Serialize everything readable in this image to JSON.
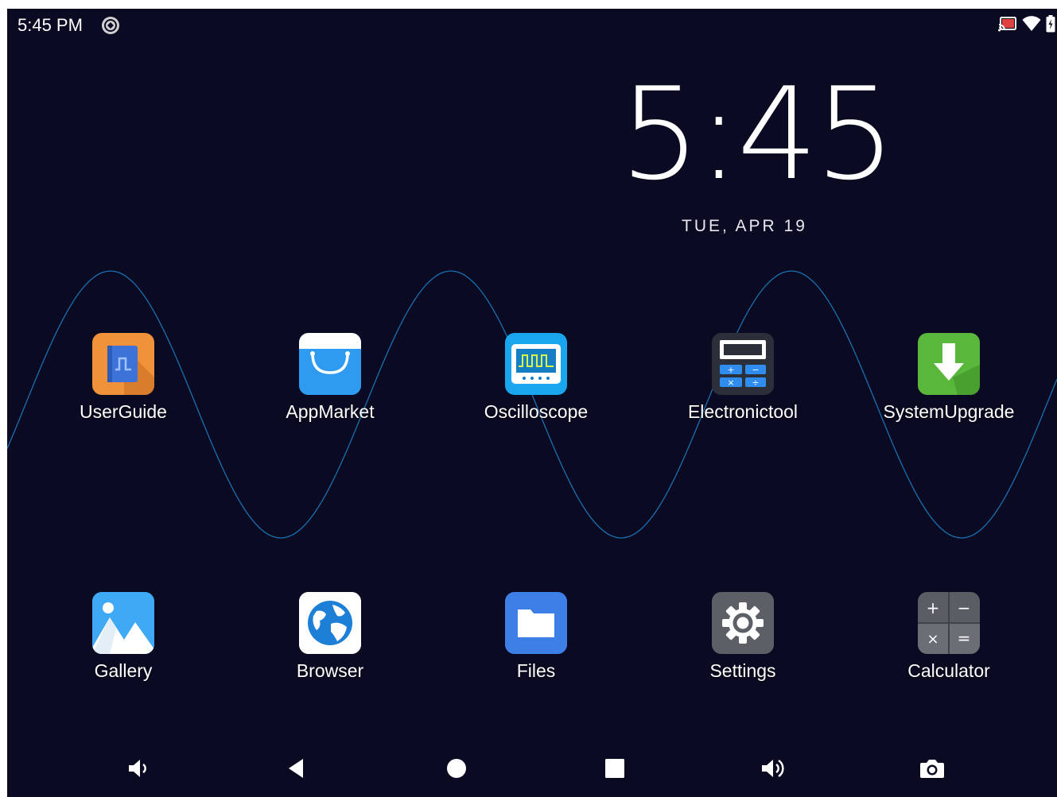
{
  "status_bar": {
    "time": "5:45 PM",
    "left_icons": [
      "notification-icon"
    ],
    "right_icons": [
      "cast-icon",
      "wifi-icon",
      "battery-icon"
    ]
  },
  "clock_widget": {
    "time": "5:45",
    "date": "TUE, APR 19"
  },
  "apps": [
    {
      "label": "UserGuide",
      "icon": "userguide-icon",
      "color": "#f0923a"
    },
    {
      "label": "AppMarket",
      "icon": "appmarket-icon",
      "color": "#2f9bf0"
    },
    {
      "label": "Oscilloscope",
      "icon": "oscilloscope-icon",
      "color": "#1aa6ef"
    },
    {
      "label": "Electronictool",
      "icon": "electronictool-icon",
      "color": "#333844"
    },
    {
      "label": "SystemUpgrade",
      "icon": "systemupgrade-icon",
      "color": "#59b83b"
    },
    {
      "label": "Gallery",
      "icon": "gallery-icon",
      "color": "#3fa9f5"
    },
    {
      "label": "Browser",
      "icon": "browser-icon",
      "color": "#1d7fd6"
    },
    {
      "label": "Files",
      "icon": "files-icon",
      "color": "#3d7fe6"
    },
    {
      "label": "Settings",
      "icon": "settings-icon",
      "color": "#5c5f66"
    },
    {
      "label": "Calculator",
      "icon": "calculator-icon",
      "color": "#5a5d64"
    }
  ],
  "navigation_bar": [
    "volume-down-icon",
    "back-icon",
    "home-icon",
    "recents-icon",
    "volume-up-icon",
    "screenshot-icon"
  ],
  "colors": {
    "background": "#0a0a22",
    "wave": "#1a6fb0"
  }
}
